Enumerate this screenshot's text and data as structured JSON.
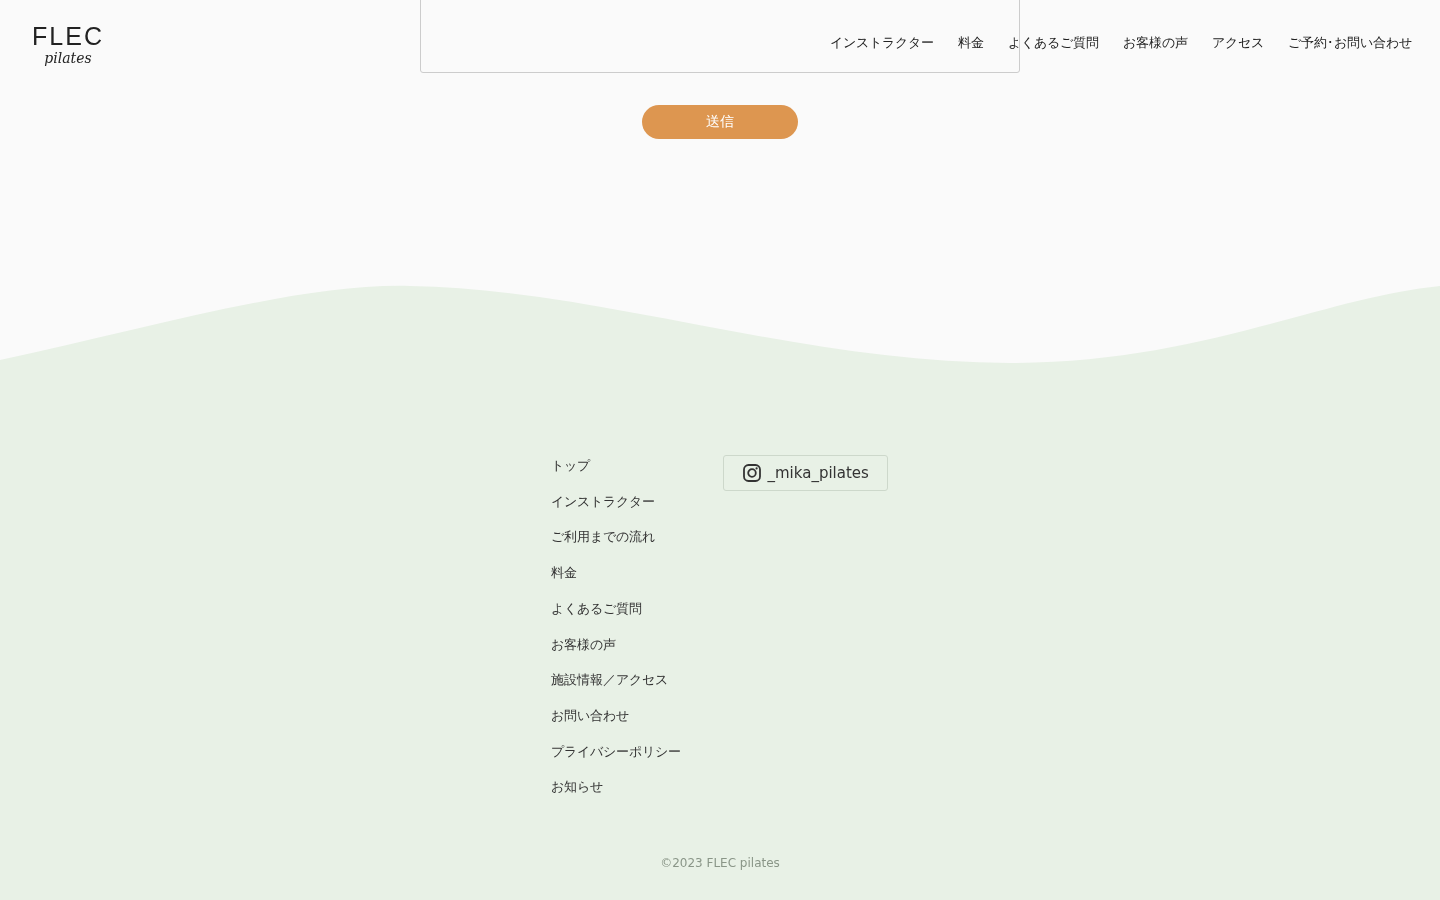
{
  "header": {
    "logo": {
      "title": "FLEC",
      "subtitle": "pilates"
    },
    "nav": [
      "インストラクター",
      "料金",
      "よくあるご質問",
      "お客様の声",
      "アクセス",
      "ご予約･お問い合わせ"
    ]
  },
  "form": {
    "submit_label": "送信"
  },
  "footer": {
    "links": [
      "トップ",
      "インストラクター",
      "ご利用までの流れ",
      "料金",
      "よくあるご質問",
      "お客様の声",
      "施設情報／アクセス",
      "お問い合わせ",
      "プライバシーポリシー",
      "お知らせ"
    ],
    "instagram": "_mika_pilates",
    "copyright": "©2023 FLEC pilates"
  }
}
